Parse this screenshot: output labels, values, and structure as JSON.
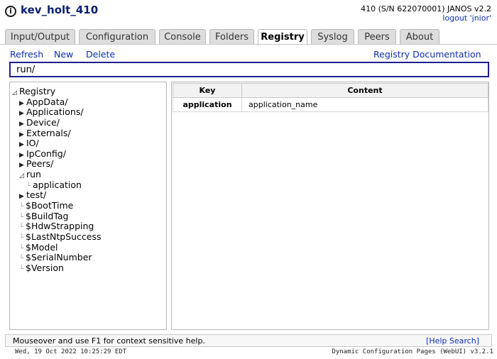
{
  "header": {
    "device_name": "kev_holt_410",
    "system_info": "410 (S/N 622070001) JANOS v2.2",
    "logout": "logout 'jnior'"
  },
  "tabs": [
    {
      "label": "Input/Output",
      "active": false
    },
    {
      "label": "Configuration",
      "active": false
    },
    {
      "label": "Console",
      "active": false
    },
    {
      "label": "Folders",
      "active": false
    },
    {
      "label": "Registry",
      "active": true
    },
    {
      "label": "Syslog",
      "active": false
    },
    {
      "label": "Peers",
      "active": false
    },
    {
      "label": "About",
      "active": false
    }
  ],
  "toolbar": {
    "refresh": "Refresh",
    "new": "New",
    "delete": "Delete",
    "documentation": "Registry Documentation"
  },
  "path_input": {
    "value": "run/"
  },
  "tree": {
    "root": "Registry",
    "items": [
      {
        "label": "AppData/",
        "type": "folder",
        "expanded": false
      },
      {
        "label": "Applications/",
        "type": "folder",
        "expanded": false
      },
      {
        "label": "Device/",
        "type": "folder",
        "expanded": false
      },
      {
        "label": "Externals/",
        "type": "folder",
        "expanded": false
      },
      {
        "label": "IO/",
        "type": "folder",
        "expanded": false
      },
      {
        "label": "IpConfig/",
        "type": "folder",
        "expanded": false
      },
      {
        "label": "Peers/",
        "type": "folder",
        "expanded": false
      },
      {
        "label": "run",
        "type": "folder",
        "expanded": true
      },
      {
        "label": "application",
        "type": "key",
        "child": true
      },
      {
        "label": "test/",
        "type": "folder",
        "expanded": false
      },
      {
        "label": "$BootTime",
        "type": "key"
      },
      {
        "label": "$BuildTag",
        "type": "key"
      },
      {
        "label": "$HdwStrapping",
        "type": "key"
      },
      {
        "label": "$LastNtpSuccess",
        "type": "key"
      },
      {
        "label": "$Model",
        "type": "key"
      },
      {
        "label": "$SerialNumber",
        "type": "key"
      },
      {
        "label": "$Version",
        "type": "key"
      }
    ]
  },
  "table": {
    "headers": [
      "Key",
      "Content"
    ],
    "rows": [
      [
        "application",
        "application_name"
      ]
    ]
  },
  "status": {
    "help_text": "Mouseover and use F1 for context sensitive help.",
    "help_search": "[Help Search]"
  },
  "footer": {
    "timestamp": "Wed, 19 Oct 2022 10:25:29 EDT",
    "version": "Dynamic Configuration Pages (WebUI) v3.2.1"
  }
}
